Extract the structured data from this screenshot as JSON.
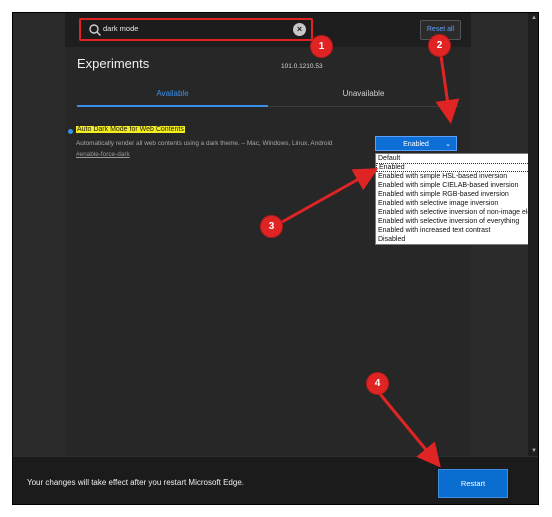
{
  "search": {
    "query": "dark mode",
    "reset_label": "Reset all"
  },
  "page": {
    "title": "Experiments",
    "version": "101.0.1210.53",
    "tabs": [
      {
        "label": "Available"
      },
      {
        "label": "Unavailable"
      }
    ]
  },
  "flag": {
    "name": "Auto Dark Mode for Web Contents",
    "description": "Automatically render all web contents using a dark theme. – Mac, Windows, Linux, Android",
    "link": "#enable-force-dark",
    "selected": "Enabled",
    "options": [
      "Default",
      "Enabled",
      "Enabled with simple HSL-based inversion",
      "Enabled with simple CIELAB-based inversion",
      "Enabled with simple RGB-based inversion",
      "Enabled with selective image inversion",
      "Enabled with selective inversion of non-image elements",
      "Enabled with selective inversion of everything",
      "Enabled with increased text contrast",
      "Disabled"
    ]
  },
  "footer": {
    "message": "Your changes will take effect after you restart Microsoft Edge.",
    "restart_label": "Restart"
  },
  "annotations": {
    "badges": [
      "1",
      "2",
      "3",
      "4"
    ],
    "color": "#e02424"
  },
  "icons": {
    "search": "search-icon",
    "clear": "clear-icon",
    "chevron": "chevron-down-icon"
  }
}
